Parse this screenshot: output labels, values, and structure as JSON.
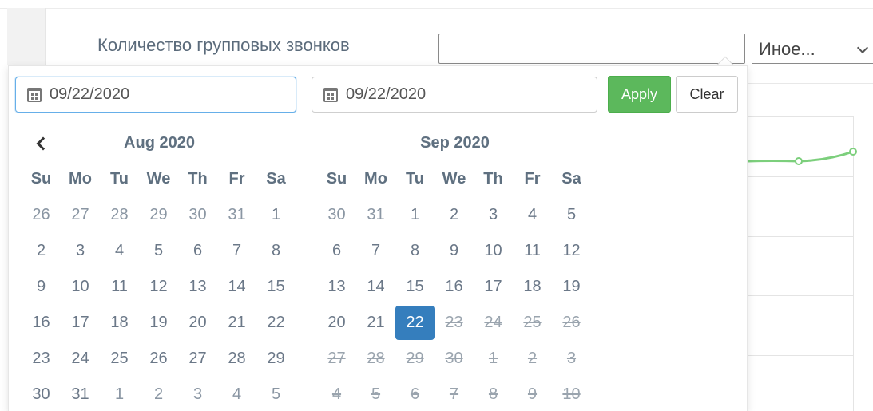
{
  "header": {
    "title": "Количество групповых звонков",
    "filter_value": "",
    "type_select_value": "Иное..."
  },
  "datepicker": {
    "start_date": "09/22/2020",
    "end_date": "09/22/2020",
    "apply_label": "Apply",
    "clear_label": "Clear",
    "weekdays": [
      "Su",
      "Mo",
      "Tu",
      "We",
      "Th",
      "Fr",
      "Sa"
    ],
    "left_month": {
      "title": "Aug 2020",
      "weeks": [
        [
          "26",
          "27",
          "28",
          "29",
          "30",
          "31",
          "1"
        ],
        [
          "2",
          "3",
          "4",
          "5",
          "6",
          "7",
          "8"
        ],
        [
          "9",
          "10",
          "11",
          "12",
          "13",
          "14",
          "15"
        ],
        [
          "16",
          "17",
          "18",
          "19",
          "20",
          "21",
          "22"
        ],
        [
          "23",
          "24",
          "25",
          "26",
          "27",
          "28",
          "29"
        ],
        [
          "30",
          "31",
          "1",
          "2",
          "3",
          "4",
          "5"
        ]
      ],
      "off_days": [
        [
          0,
          0
        ],
        [
          0,
          1
        ],
        [
          0,
          2
        ],
        [
          0,
          3
        ],
        [
          0,
          4
        ],
        [
          0,
          5
        ],
        [
          5,
          2
        ],
        [
          5,
          3
        ],
        [
          5,
          4
        ],
        [
          5,
          5
        ],
        [
          5,
          6
        ]
      ]
    },
    "right_month": {
      "title": "Sep 2020",
      "weeks": [
        [
          "30",
          "31",
          "1",
          "2",
          "3",
          "4",
          "5"
        ],
        [
          "6",
          "7",
          "8",
          "9",
          "10",
          "11",
          "12"
        ],
        [
          "13",
          "14",
          "15",
          "16",
          "17",
          "18",
          "19"
        ],
        [
          "20",
          "21",
          "22",
          "23",
          "24",
          "25",
          "26"
        ],
        [
          "27",
          "28",
          "29",
          "30",
          "1",
          "2",
          "3"
        ],
        [
          "4",
          "5",
          "6",
          "7",
          "8",
          "9",
          "10"
        ]
      ],
      "off_days": [
        [
          0,
          0
        ],
        [
          0,
          1
        ]
      ],
      "selected_day": [
        3,
        2
      ],
      "disabled_from": [
        3,
        3
      ]
    }
  },
  "colors": {
    "apply_green": "#5cb85c",
    "selected_blue": "#357ebd",
    "chart_line": "#7ccf7c"
  }
}
